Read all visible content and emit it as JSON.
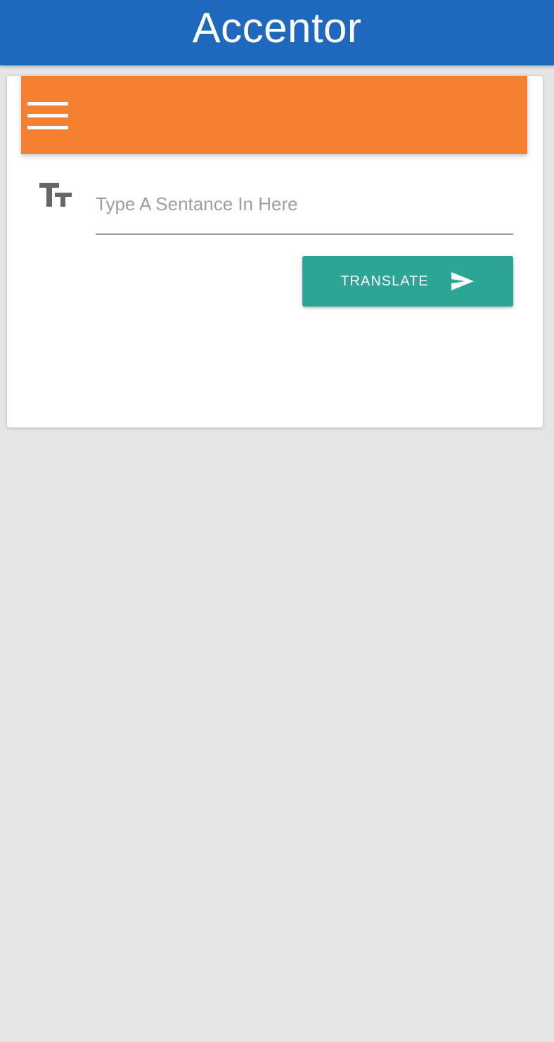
{
  "app_bar": {
    "title": "Accentor",
    "color": "#1e68bd"
  },
  "card": {
    "toolbar": {
      "color": "#f3812f",
      "menu_icon": "hamburger-menu-icon"
    },
    "input": {
      "icon": "text-fields-icon",
      "value": "",
      "placeholder": "Type A Sentance In Here"
    },
    "translate_button": {
      "label": "TRANSLATE",
      "icon": "send-icon",
      "color": "#2da596"
    }
  },
  "background_color": "#e5e5e5"
}
